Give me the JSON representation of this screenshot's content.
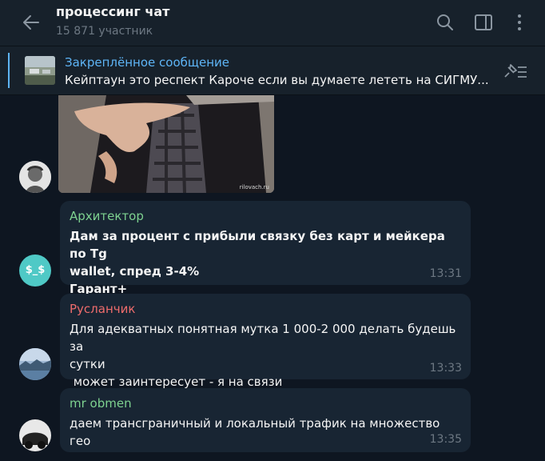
{
  "header": {
    "title": "процессинг чат",
    "subtitle": "15 871 участник"
  },
  "pinned": {
    "title": "Закреплённое сообщение",
    "text": "Кейптаун это респект   Кароче если вы думаете лететь на СИГМУ..."
  },
  "image_message": {
    "caption": "rilovach.ru"
  },
  "messages": [
    {
      "sender": "Архитектор",
      "sender_color": "#7ed290",
      "avatar_text": "$_$",
      "avatar_color": "#4fc9c6",
      "text": "Дам за процент с прибыли связку без карт и мейкера по Tg\nwallet, спред 3-4%\nГарант+",
      "time": "13:31"
    },
    {
      "sender": "Русланчик",
      "sender_color": "#ee6c6c",
      "text": "Для адекватных понятная мутка 1 000-2 000 делать будешь за\nсутки\n может заинтересует - я на связи",
      "time": "13:33"
    },
    {
      "sender": "mr obmen",
      "sender_color": "#7ed290",
      "text": "даем трансграничный и локальный трафик на множество гео",
      "time": "13:35"
    }
  ],
  "colors": {
    "background": "#0e1621",
    "panel": "#17212b",
    "bubble": "#182533",
    "accent": "#5eb5f7",
    "secondary_text": "#6d7883"
  },
  "icons": {
    "back": "arrow-left-icon",
    "search": "search-icon",
    "sidebar": "sidebar-toggle-icon",
    "menu": "more-vertical-icon",
    "unpin": "unpin-icon"
  }
}
